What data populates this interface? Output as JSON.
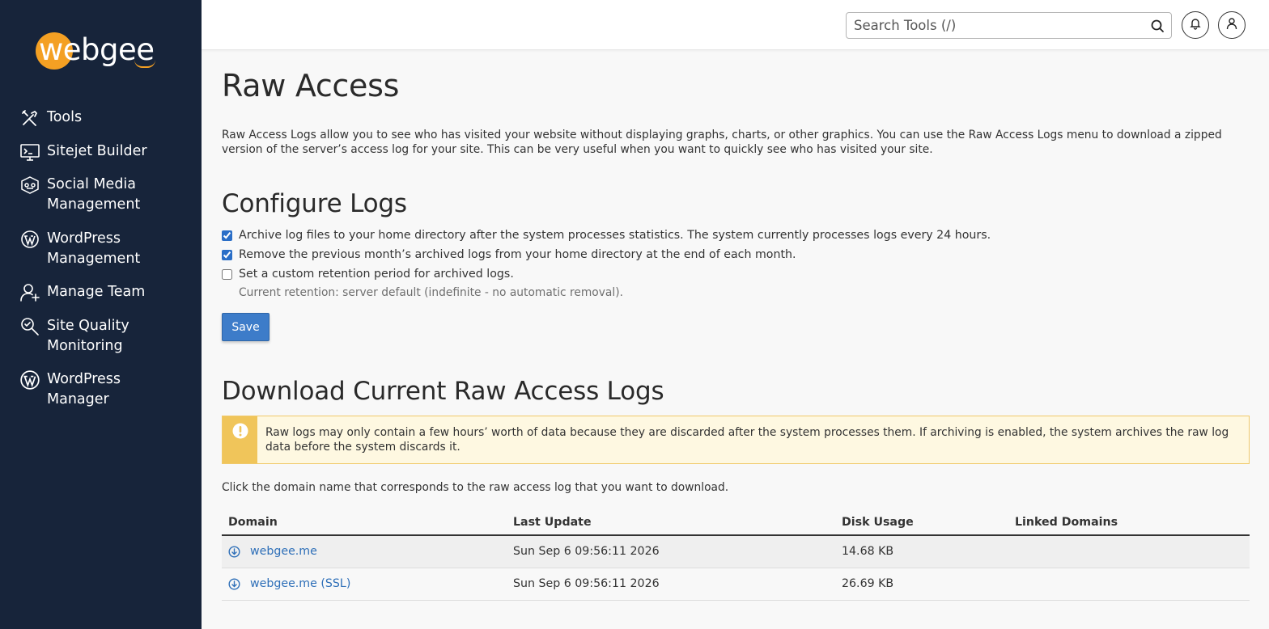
{
  "brand": {
    "name": "webgee",
    "accent": "#f4a023",
    "sidebar_bg": "#17243a"
  },
  "sidebar": {
    "items": [
      {
        "label": "Tools",
        "icon": "tools-icon"
      },
      {
        "label": "Sitejet Builder",
        "icon": "monitor-icon"
      },
      {
        "label": "Social Media Management",
        "icon": "social-icon"
      },
      {
        "label": "WordPress Management",
        "icon": "wordpress-icon"
      },
      {
        "label": "Manage Team",
        "icon": "add-user-icon"
      },
      {
        "label": "Site Quality Monitoring",
        "icon": "magnifier-icon"
      },
      {
        "label": "WordPress Manager",
        "icon": "wordpress-icon"
      }
    ]
  },
  "header": {
    "search_placeholder": "Search Tools (/)",
    "search_icon": "search-icon",
    "notifications_icon": "bell-icon",
    "user_icon": "user-icon"
  },
  "page": {
    "title": "Raw Access",
    "intro": "Raw Access Logs allow you to see who has visited your website without displaying graphs, charts, or other graphics. You can use the Raw Access Logs menu to download a zipped version of the server’s access log for your site. This can be very useful when you want to quickly see who has visited your site."
  },
  "configure": {
    "heading": "Configure Logs",
    "options": [
      {
        "label": "Archive log files to your home directory after the system processes statistics. The system currently processes logs every 24 hours.",
        "checked": true
      },
      {
        "label": "Remove the previous month’s archived logs from your home directory at the end of each month.",
        "checked": true
      },
      {
        "label": "Set a custom retention period for archived logs.",
        "checked": false
      }
    ],
    "retention_note": "Current retention: server default (indefinite - no automatic removal).",
    "save_label": "Save"
  },
  "download": {
    "heading": "Download Current Raw Access Logs",
    "warning": "Raw logs may only contain a few hours’ worth of data because they are discarded after the system processes them. If archiving is enabled, the system archives the raw log data before the system discards it.",
    "instruction": "Click the domain name that corresponds to the raw access log that you want to download.",
    "columns": [
      "Domain",
      "Last Update",
      "Disk Usage",
      "Linked Domains"
    ],
    "rows": [
      {
        "domain": "webgee.me",
        "last_update": "Sun Sep 6 09:56:11 2026",
        "disk_usage": "14.68 KB",
        "linked": ""
      },
      {
        "domain": "webgee.me (SSL)",
        "last_update": "Sun Sep 6 09:56:11 2026",
        "disk_usage": "26.69 KB",
        "linked": ""
      }
    ]
  }
}
